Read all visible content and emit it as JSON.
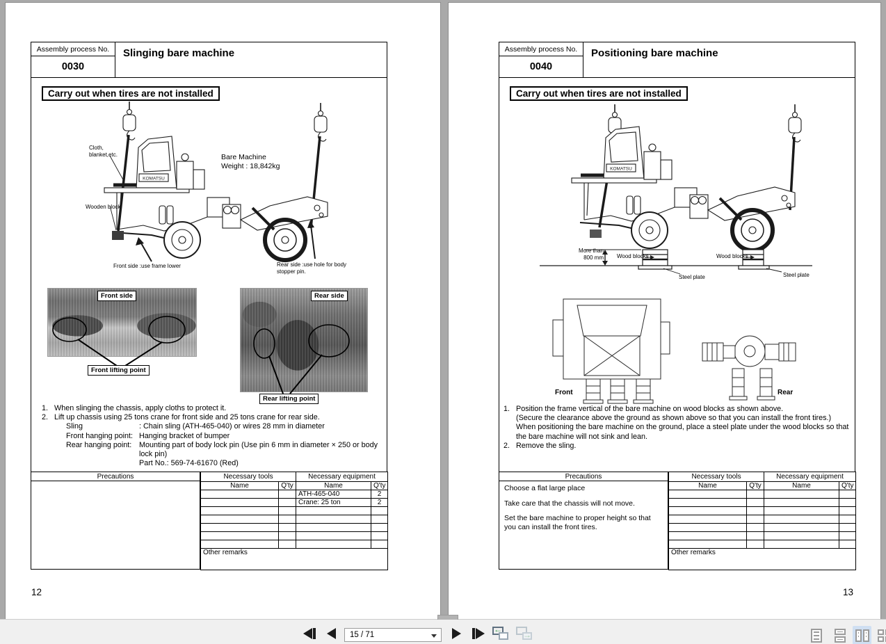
{
  "toolbar": {
    "page_indicator": "15 / 71",
    "selected_view": "two-page-view"
  },
  "pages": {
    "left": {
      "page_number": "12",
      "header": {
        "process_label": "Assembly process No.",
        "process_no": "0030",
        "title": "Slinging bare machine"
      },
      "banner": "Carry out when tires are not installed",
      "diagram_labels": {
        "brand": "KOMATSU",
        "cloth": "Cloth,\nblanket,etc.",
        "wooden_block": "Wooden block",
        "weight": "Bare Machine\nWeight : 18,842kg",
        "front_note": "Front side :use frame lower",
        "rear_note": "Rear side :use hole for body\nstopper pin."
      },
      "photos": {
        "front_title": "Front side",
        "front_caption": "Front lifting point",
        "rear_title": "Rear side",
        "rear_caption": "Rear lifting point"
      },
      "steps": [
        {
          "marker": "1.",
          "label": "",
          "text": "When slinging the chassis, apply cloths to protect it."
        },
        {
          "marker": "2.",
          "label": "",
          "text": "Lift up chassis using 25 tons crane for front side and 25 tons crane for rear side."
        },
        {
          "marker": "",
          "label": "Sling",
          "text": ":  Chain sling (ATH-465-040) or wires 28 mm in diameter"
        },
        {
          "marker": "",
          "label": "Front hanging point:",
          "text": "Hanging bracket of bumper"
        },
        {
          "marker": "",
          "label": "Rear hanging point:",
          "text": "Mounting part of body lock pin (Use pin 6 mm in diameter × 250 or body lock pin)"
        },
        {
          "marker": "",
          "label": " ",
          "text": "Part No.: 569-74-61670 (Red)"
        }
      ],
      "table": {
        "precautions_header": "Precautions",
        "tools_header": "Necessary tools",
        "equipment_header": "Necessary equipment",
        "name_header": "Name",
        "qty_header": "Q'ty",
        "other_remarks": "Other remarks",
        "precautions": [],
        "rows": [
          {
            "tool_name": "",
            "tool_qty": "",
            "equip_name": "ATH-465-040",
            "equip_qty": "2"
          },
          {
            "tool_name": "",
            "tool_qty": "",
            "equip_name": "Crane: 25 ton",
            "equip_qty": "2"
          },
          {
            "tool_name": "",
            "tool_qty": "",
            "equip_name": "",
            "equip_qty": ""
          },
          {
            "tool_name": "",
            "tool_qty": "",
            "equip_name": "",
            "equip_qty": ""
          },
          {
            "tool_name": "",
            "tool_qty": "",
            "equip_name": "",
            "equip_qty": ""
          },
          {
            "tool_name": "",
            "tool_qty": "",
            "equip_name": "",
            "equip_qty": ""
          },
          {
            "tool_name": "",
            "tool_qty": "",
            "equip_name": "",
            "equip_qty": ""
          }
        ]
      }
    },
    "right": {
      "page_number": "13",
      "header": {
        "process_label": "Assembly process No.",
        "process_no": "0040",
        "title": "Positioning bare machine"
      },
      "banner": "Carry out when tires are not installed",
      "diagram_labels": {
        "brand": "KOMATSU",
        "more_than": "More than\n800 mm",
        "wood_blocks_1": "Wood blocks",
        "wood_blocks_2": "Wood blocks",
        "steel_plate_1": "Steel plate",
        "steel_plate_2": "Steel plate",
        "front_view": "Front",
        "rear_view": "Rear"
      },
      "steps": [
        {
          "marker": "1.",
          "label": "",
          "text": "Position the frame vertical of the bare machine on wood blocks as shown above."
        },
        {
          "marker": "",
          "label": "",
          "text": "(Secure the clearance above the ground as shown above so that you can install the front tires.)"
        },
        {
          "marker": "",
          "label": "",
          "text": "When positioning the bare machine on the ground, place a steel plate under the wood blocks so that the bare machine will not sink and lean."
        },
        {
          "marker": "2.",
          "label": "",
          "text": "Remove the sling."
        }
      ],
      "table": {
        "precautions_header": "Precautions",
        "tools_header": "Necessary tools",
        "equipment_header": "Necessary equipment",
        "name_header": "Name",
        "qty_header": "Q'ty",
        "other_remarks": "Other remarks",
        "precautions": [
          "Choose a flat large place",
          "Take care that the chassis will not move.",
          "Set the bare machine to proper height so that you can install the front tires."
        ],
        "rows": [
          {
            "tool_name": "",
            "tool_qty": "",
            "equip_name": "",
            "equip_qty": ""
          },
          {
            "tool_name": "",
            "tool_qty": "",
            "equip_name": "",
            "equip_qty": ""
          },
          {
            "tool_name": "",
            "tool_qty": "",
            "equip_name": "",
            "equip_qty": ""
          },
          {
            "tool_name": "",
            "tool_qty": "",
            "equip_name": "",
            "equip_qty": ""
          },
          {
            "tool_name": "",
            "tool_qty": "",
            "equip_name": "",
            "equip_qty": ""
          },
          {
            "tool_name": "",
            "tool_qty": "",
            "equip_name": "",
            "equip_qty": ""
          },
          {
            "tool_name": "",
            "tool_qty": "",
            "equip_name": "",
            "equip_qty": ""
          }
        ]
      }
    }
  }
}
